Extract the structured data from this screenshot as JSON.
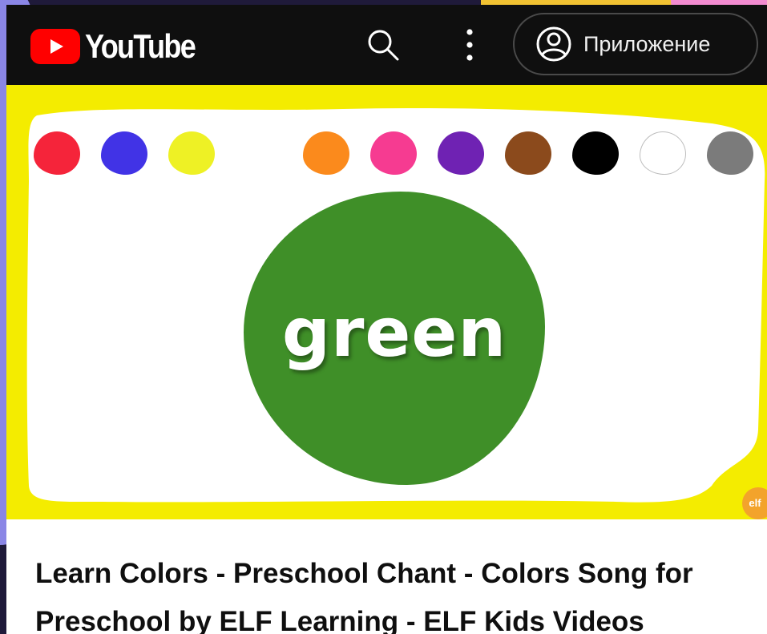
{
  "header": {
    "logo_text": "YouTube",
    "app_button_label": "Приложение",
    "icons": [
      "youtube-logo-icon",
      "search-icon",
      "more-vert-icon",
      "account-circle-icon"
    ]
  },
  "video": {
    "thumbnail_word": "green",
    "channel_logo_text": "elf",
    "palette_colors": [
      "#f5243a",
      "#4133e6",
      "#eef125",
      "#fb8a1c",
      "#f63b91",
      "#6f22b3",
      "#8b4a1c",
      "#000000",
      "#ffffff",
      "#7b7b7b"
    ],
    "featured_color": "#3f8f28"
  },
  "title": "Learn Colors - Preschool Chant - Colors Song for Preschool by ELF Learning - ELF Kids Videos"
}
